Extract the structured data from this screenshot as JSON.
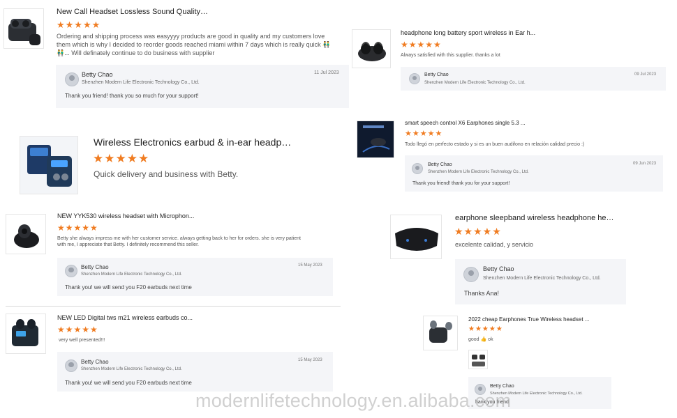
{
  "reviews": [
    {
      "product_title": "New Call Headset Lossless Sound Quality Ster...",
      "stars": "★★★★★",
      "review": "Ordering and shipping process was easyyyy products are good in quality and my customers love them which is why I decided to reorder goods reached miami within 7 days which is really quick 👬👬... Will definately continue to do business with supplier",
      "reply_name": "Betty Chao",
      "reply_company": "Shenzhen Modern Life Electronic Technology Co., Ltd.",
      "reply_date": "11 Jul 2023",
      "reply_text": "Thank you friend! thank you so much for your support!"
    },
    {
      "product_title": "headphone long battery sport wireless in Ear h...",
      "stars": "★★★★★",
      "review": "Always satisfied with this supplier. thanks a lot",
      "reply_name": "Betty Chao",
      "reply_company": "Shenzhen Modern Life Electronic Technology Co., Ltd.",
      "reply_date": "09 Jul 2023"
    },
    {
      "product_title": "Wireless Electronics earbud & in-ear headphon...",
      "stars": "★★★★★",
      "review": "Quick delivery and business with Betty."
    },
    {
      "product_title": "smart speech control X6 Earphones single 5.3 ...",
      "stars": "★★★★★",
      "review": "Todo llegó en perfecto estado y si es un buen audifono en relación calidad precio :)",
      "reply_name": "Betty Chao",
      "reply_company": "Shenzhen Modern Life Electronic Technology Co., Ltd.",
      "reply_date": "09 Jun 2023",
      "reply_text": "Thank you friend! thank you for your support!"
    },
    {
      "product_title": "NEW YYK530 wireless headset with Microphon...",
      "stars": "★★★★★",
      "review": "Betty she always impress me with her customer service. always getting back to her for orders. she is very patient with me, I appreciate that Betty. I definitely recommend this seller.",
      "reply_name": "Betty Chao",
      "reply_company": "Shenzhen Modern Life Electronic Technology Co., Ltd.",
      "reply_date": "15 May 2023",
      "reply_text": "Thank you! we will send you F20 earbuds next time"
    },
    {
      "product_title": "earphone sleepband wireless headphone head...",
      "stars": "★★★★★",
      "review": "excelente calidad, y servicio",
      "reply_name": "Betty Chao",
      "reply_company": "Shenzhen Modern Life Electronic Technology Co., Ltd.",
      "reply_text": "Thanks Ana!"
    },
    {
      "product_title": "NEW LED Digital tws m21 wireless earbuds co...",
      "stars": "★★★★★",
      "review": "very well presented!!!",
      "reply_name": "Betty Chao",
      "reply_company": "Shenzhen Modern Life Electronic Technology Co., Ltd.",
      "reply_date": "15 May 2023",
      "reply_text": "Thank you! we will send you F20 earbuds next time"
    },
    {
      "product_title": "2022 cheap Earphones True Wireless headset ...",
      "stars": "★★★★★",
      "review": "good 👍 ok",
      "reply_name": "Betty Chao",
      "reply_company": "Shenzhen Modern Life Electronic Technology Co., Ltd.",
      "reply_text": "hank you friend"
    }
  ],
  "watermark": "modernlifetechnology.en.alibaba.com",
  "colors": {
    "star": "#f07c21",
    "reply_bg": "#f4f5f8",
    "title": "#1f1f1f"
  }
}
